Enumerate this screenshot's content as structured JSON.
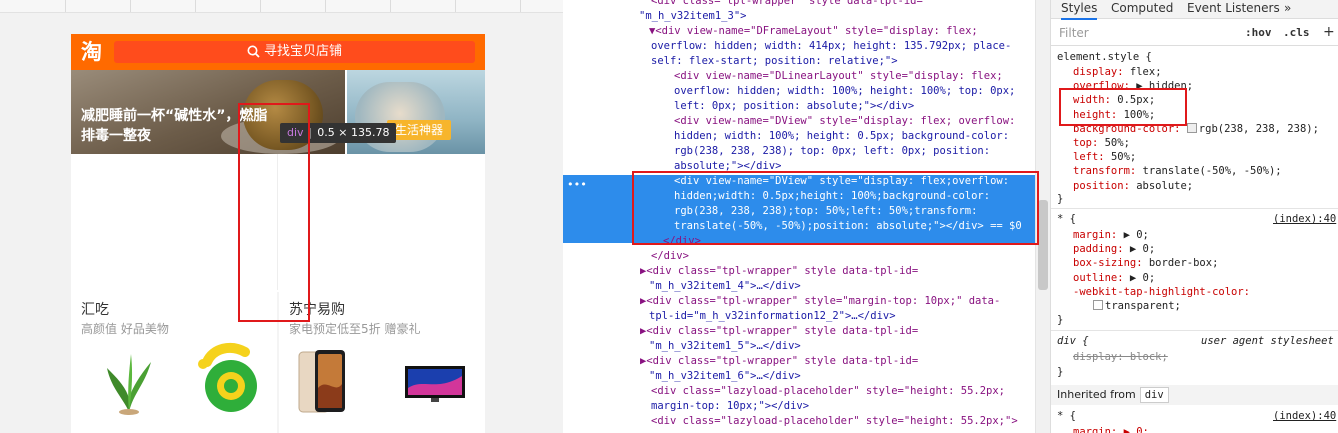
{
  "preview": {
    "logo": "淘",
    "search_placeholder": "寻找宝贝店铺",
    "banner_title_line1": "减肥睡前一杯“碱性水”，燃脂",
    "banner_title_line2": "排毒一整夜",
    "banner_tag": "生活神器",
    "tooltip_tag": "div",
    "tooltip_size": "0.5 × 135.78",
    "cards": [
      {
        "title": "汇吃",
        "subtitle": "高颜值 好品美物"
      },
      {
        "title": "苏宁易购",
        "subtitle": "家电预定低至5折 赠豪礼"
      }
    ]
  },
  "dom": {
    "lines": [
      "<div class=\"tpl-wrapper\" style data-tpl-id=",
      "\"m_h_v32item1_3\">",
      "▼<div view-name=\"DFrameLayout\" style=\"display: flex;",
      "overflow: hidden; width: 414px; height: 135.792px; place-",
      "self: flex-start; position: relative;\">",
      "<div view-name=\"DLinearLayout\" style=\"display: flex;",
      "overflow: hidden; width: 100%; height: 100%; top: 0px;",
      "left: 0px; position: absolute;\"></div>",
      "<div view-name=\"DView\" style=\"display: flex; overflow:",
      "hidden; width: 100%; height: 0.5px; background-color:",
      "rgb(238, 238, 238); top: 0px; left: 0px; position:",
      "absolute;\"></div>",
      "<div view-name=\"DView\" style=\"display: flex;overflow:",
      "hidden;width: 0.5px;height: 100%;background-color:",
      "rgb(238, 238, 238);top: 50%;left: 50%;transform:",
      "translate(-50%, -50%);position: absolute;\"></div> == $0",
      "</div>",
      "</div>",
      "▶<div class=\"tpl-wrapper\" style data-tpl-id=",
      "\"m_h_v32item1_4\">…</div>",
      "▶<div class=\"tpl-wrapper\" style=\"margin-top: 10px;\" data-",
      "tpl-id=\"m_h_v32information12_2\">…</div>",
      "▶<div class=\"tpl-wrapper\" style data-tpl-id=",
      "\"m_h_v32item1_5\">…</div>",
      "▶<div class=\"tpl-wrapper\" style data-tpl-id=",
      "\"m_h_v32item1_6\">…</div>",
      "<div class=\"lazyload-placeholder\" style=\"height: 55.2px;",
      "margin-top: 10px;\"></div>",
      "<div class=\"lazyload-placeholder\" style=\"height: 55.2px;\">"
    ],
    "ellipsis": "•••"
  },
  "styles": {
    "tabs": [
      "Styles",
      "Computed",
      "Event Listeners",
      "»"
    ],
    "filter_placeholder": "Filter",
    "hov": ":hov",
    "cls": ".cls",
    "plus": "+",
    "element_style_selector": "element.style {",
    "element_props": [
      {
        "name": "display",
        "value": "flex;"
      },
      {
        "name": "overflow",
        "value": "▶ hidden;"
      },
      {
        "name": "width",
        "value": "0.5px;"
      },
      {
        "name": "height",
        "value": "100%;"
      },
      {
        "name": "background-color",
        "value": "rgb(238, 238, 238);"
      },
      {
        "name": "top",
        "value": "50%;"
      },
      {
        "name": "left",
        "value": "50%;"
      },
      {
        "name": "transform",
        "value": "translate(-50%, -50%);"
      },
      {
        "name": "position",
        "value": "absolute;"
      }
    ],
    "close_brace": "}",
    "star_selector": "* {",
    "star_source": "(index):40",
    "star_props": [
      {
        "name": "margin",
        "value": "▶ 0;"
      },
      {
        "name": "padding",
        "value": "▶ 0;"
      },
      {
        "name": "box-sizing",
        "value": "border-box;"
      },
      {
        "name": "outline",
        "value": "▶ 0;"
      },
      {
        "name": "-webkit-tap-highlight-color",
        "value": ""
      },
      {
        "name": "",
        "value": "transparent;"
      }
    ],
    "ua_selector": "div {",
    "ua_source": "user agent stylesheet",
    "ua_prop": "display: block;",
    "inherited_label": "Inherited from",
    "inherited_chip": "div",
    "star2_selector": "* {",
    "star2_source": "(index):40",
    "star2_prop": "margin: ▶ 0;"
  }
}
